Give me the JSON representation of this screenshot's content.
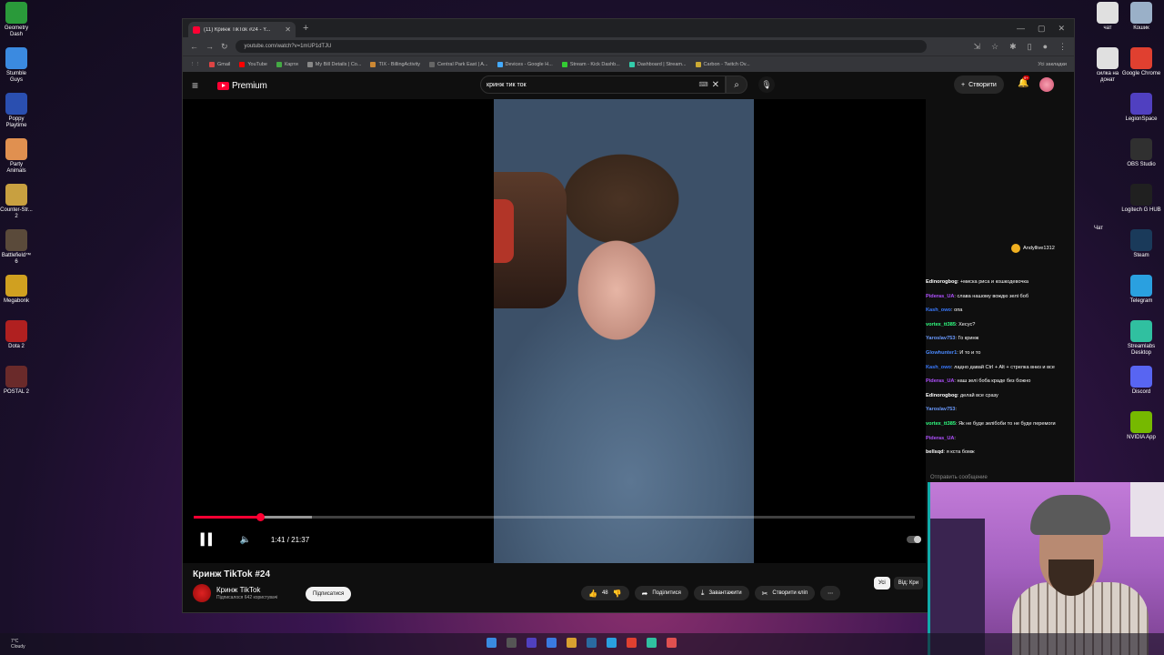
{
  "desktop_left": [
    {
      "label": "Geometry Dash",
      "color": "#2a9a3a"
    },
    {
      "label": "Stumble Guys",
      "color": "#3b8ae0"
    },
    {
      "label": "Poppy Playtime",
      "color": "#2a4fb0"
    },
    {
      "label": "Party Animals",
      "color": "#e09050"
    },
    {
      "label": "Counter-Str... 2",
      "color": "#c8a040"
    },
    {
      "label": "Battlefield™ 6",
      "color": "#5a4a3a"
    },
    {
      "label": "Megabonk",
      "color": "#d0a020"
    },
    {
      "label": "Dota 2",
      "color": "#b02020"
    },
    {
      "label": "POSTAL 2",
      "color": "#6a2a2a"
    }
  ],
  "desktop_right": [
    {
      "label": "Кошик",
      "color": "#9ab0c8"
    },
    {
      "label": "Google Chrome",
      "color": "#e04030"
    },
    {
      "label": "LegionSpace",
      "color": "#5040c0"
    },
    {
      "label": "OBS Studio",
      "color": "#303030"
    },
    {
      "label": "Logitech G HUB",
      "color": "#202020"
    },
    {
      "label": "Steam",
      "color": "#1a3a5a"
    },
    {
      "label": "Telegram",
      "color": "#2aa0e0"
    },
    {
      "label": "Streamlabs Desktop",
      "color": "#30c0a0"
    },
    {
      "label": "Discord",
      "color": "#5865f2"
    },
    {
      "label": "NVIDIA App",
      "color": "#76b900"
    }
  ],
  "desktop_right2": [
    {
      "label": "чат",
      "color": "#e0e0e0"
    },
    {
      "label": "силка на донат",
      "color": "#e0e0e0"
    }
  ],
  "browser": {
    "tab_title": "(11) Кринж TikTok #24 - Y...",
    "url": "youtube.com/watch?v=1mUP1dTJU",
    "bookmarks": [
      {
        "label": "Gmail",
        "color": "#d44"
      },
      {
        "label": "YouTube",
        "color": "#f00"
      },
      {
        "label": "Карти",
        "color": "#4a4"
      },
      {
        "label": "My Bill Details | Co...",
        "color": "#888"
      },
      {
        "label": "TIX - BillingActivity",
        "color": "#c83"
      },
      {
        "label": "Central Park East | A...",
        "color": "#666"
      },
      {
        "label": "Devices - Google H...",
        "color": "#4af"
      },
      {
        "label": "Stream - Kick Dashb...",
        "color": "#3c3"
      },
      {
        "label": "Dashboard | Stream...",
        "color": "#3ca"
      },
      {
        "label": "Carbon - Twitch Ov...",
        "color": "#ca3"
      }
    ],
    "all_bookmarks": "Усі закладки"
  },
  "yt": {
    "logo": "Premium",
    "search_value": "кринж тик ток",
    "create": "Створити",
    "notif_badge": "9+",
    "time": "1:41 / 21:37",
    "progress_fraction": 0.092,
    "buffered_fraction": 0.164,
    "title": "Кринж TikTok #24",
    "channel": "Кринж TikTok",
    "subs": "Підписалося 642 користувачі",
    "subscribe": "Підписатися",
    "likes": "48",
    "share": "Поділитися",
    "download": "Завантажити",
    "clip": "Створити кліп",
    "chip_all": "Усі",
    "chip_from": "Від: Кри"
  },
  "chat": {
    "label": "Чат",
    "donor": "Andyllive1312",
    "messages": [
      {
        "user": "Edinorogbog",
        "color": "#ffffff",
        "text": ": +миска риса и кошкодевочка"
      },
      {
        "user": "Pideras_UA",
        "color": "#b050ff",
        "text": ": слава нашому вождю зелі боб"
      },
      {
        "user": "Kash_owo",
        "color": "#3a7aff",
        "text": ": опа"
      },
      {
        "user": "vortex_tt385",
        "color": "#30ff80",
        "text": ": Хесус?"
      },
      {
        "user": "Yaroslav753",
        "color": "#6a9aff",
        "text": ": Го кринж"
      },
      {
        "user": "Glowhunter1",
        "color": "#4a8aff",
        "text": ": И то и то"
      },
      {
        "user": "Kash_owo",
        "color": "#3a7aff",
        "text": ": ладно давай Ctrl + Alt + стрелка вниз и все"
      },
      {
        "user": "Pideras_UA",
        "color": "#b050ff",
        "text": ": наш зелі боба краде без божно"
      },
      {
        "user": "Edinorogbog",
        "color": "#ffffff",
        "text": ": делай все сразу"
      },
      {
        "user": "Yaroslav753",
        "color": "#6a9aff",
        "text": ":"
      },
      {
        "user": "vortex_tt385",
        "color": "#30ff80",
        "text": ": Як не буде зелібоби то не буде перемоги"
      },
      {
        "user": "Pideras_UA",
        "color": "#b050ff",
        "text": ":"
      },
      {
        "user": "bellsqd",
        "color": "#ffffff",
        "text": ": я кста бомж"
      }
    ],
    "input_placeholder": "Отправить сообщение"
  },
  "taskbar": {
    "weather_temp": "7°C",
    "weather_desc": "Cloudy"
  }
}
